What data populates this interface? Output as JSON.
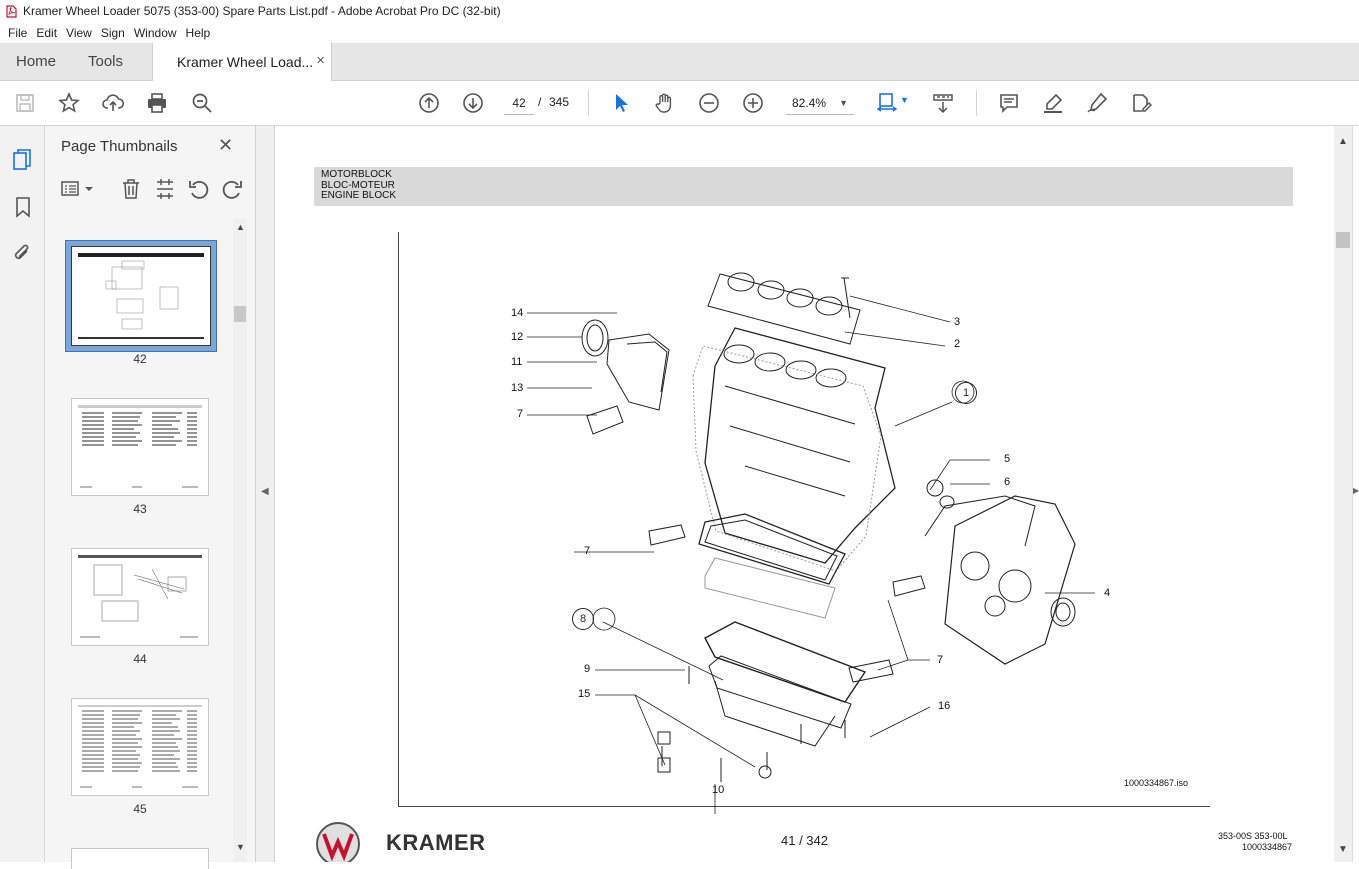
{
  "window": {
    "title": "Kramer Wheel Loader 5075 (353-00) Spare Parts List.pdf - Adobe Acrobat Pro DC (32-bit)"
  },
  "menu": [
    "File",
    "Edit",
    "View",
    "Sign",
    "Window",
    "Help"
  ],
  "tabs": {
    "home": "Home",
    "tools": "Tools",
    "document": "Kramer Wheel Load...",
    "close": "×"
  },
  "toolbar": {
    "page_current": "42",
    "page_sep": "/",
    "page_total": "345",
    "zoom": "82.4%"
  },
  "sidebar": {
    "panel_title": "Page Thumbnails",
    "close": "✕",
    "thumbnails": [
      {
        "label": "42"
      },
      {
        "label": "43"
      },
      {
        "label": "44"
      },
      {
        "label": "45"
      }
    ]
  },
  "document": {
    "header": {
      "line1": "MOTORBLOCK",
      "line2": "BLOC-MOTEUR",
      "line3": "ENGINE BLOCK"
    },
    "callouts": [
      "14",
      "12",
      "11",
      "13",
      "7",
      "3",
      "2",
      "1",
      "5",
      "6",
      "7",
      "8",
      "9",
      "15",
      "10",
      "16",
      "7",
      "4"
    ],
    "drawing_id": "1000334867.iso",
    "footer": {
      "brand": "KRAMER",
      "page_label": "41 / 342",
      "ref_line1": "353-00S   353-00L",
      "ref_line2": "1000334867"
    }
  },
  "colors": {
    "accent_blue": "#1473e6",
    "header_band": "#d9d9d9",
    "icon_gray": "#5a5a5a"
  }
}
